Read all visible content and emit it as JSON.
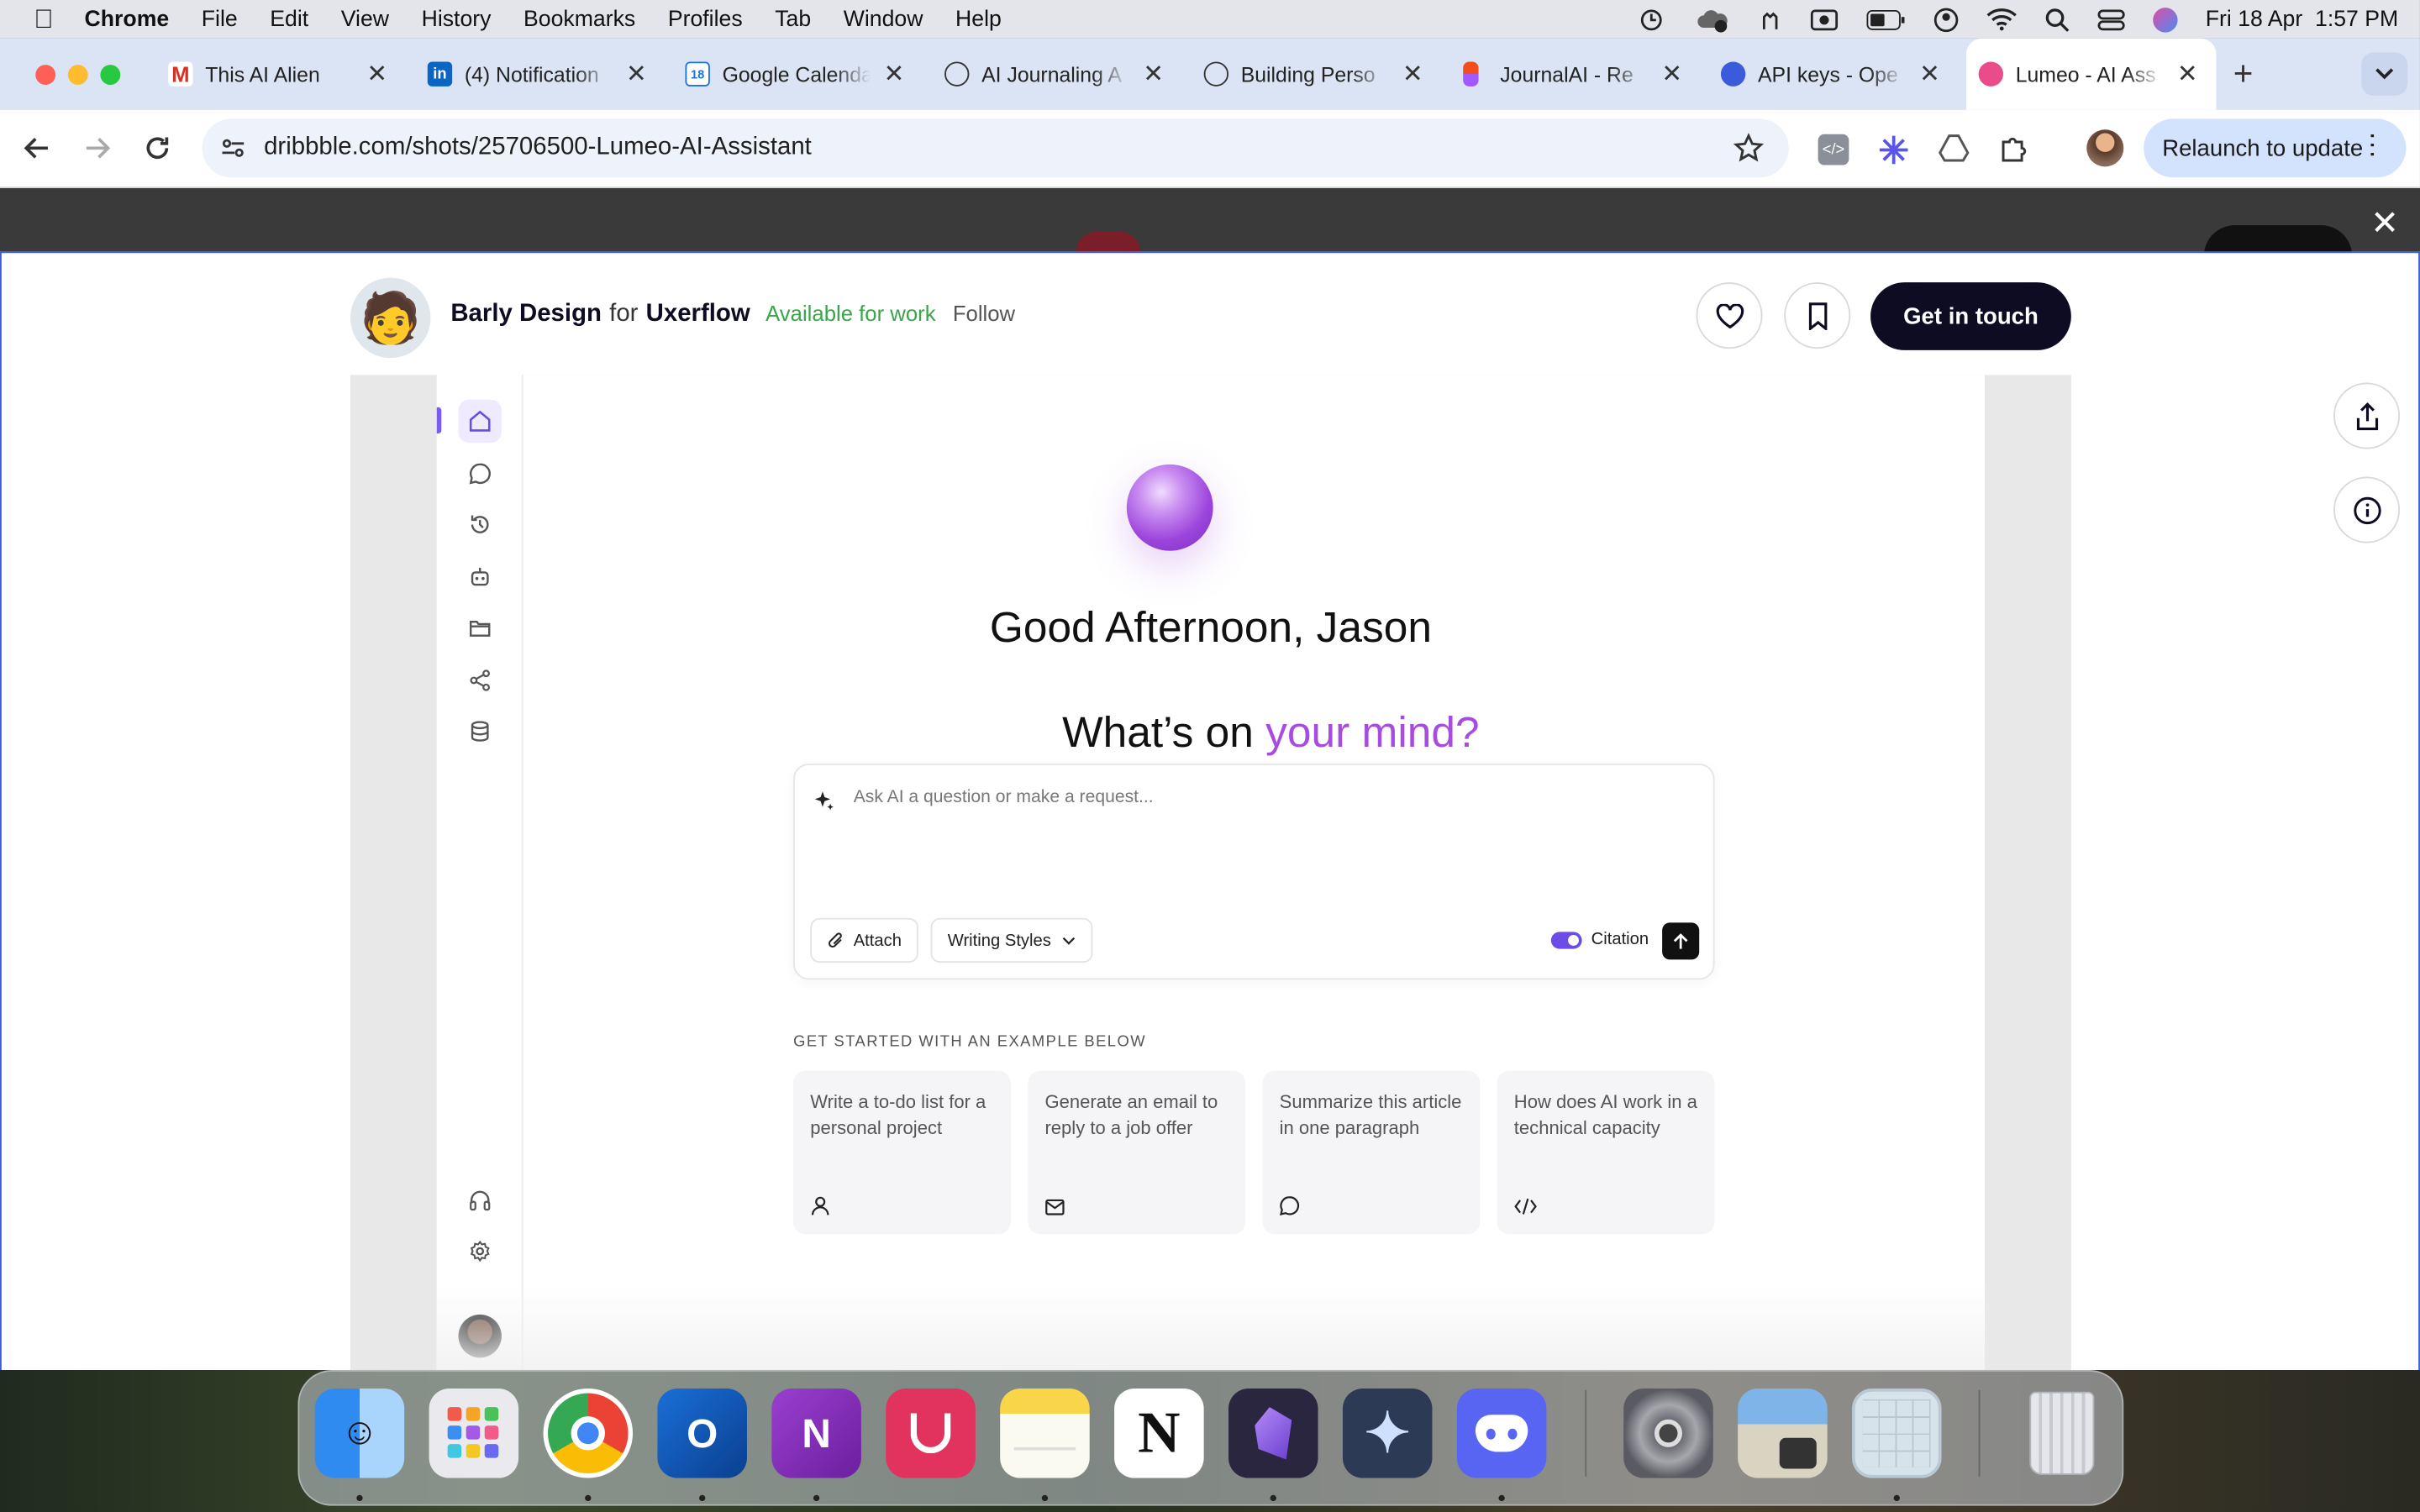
{
  "menubar": {
    "app_name": "Chrome",
    "items": [
      "File",
      "Edit",
      "View",
      "History",
      "Bookmarks",
      "Profiles",
      "Tab",
      "Window",
      "Help"
    ],
    "datetime": "Fri 18 Apr  1:57 PM"
  },
  "tabs": [
    {
      "title": "This AI Alien",
      "icon": "gmail-icon",
      "color": "#d93025"
    },
    {
      "title": "(4) Notification",
      "icon": "linkedin-icon",
      "color": "#0a66c2"
    },
    {
      "title": "Google Calenda",
      "icon": "calendar-icon",
      "color": "#1a73e8"
    },
    {
      "title": "AI Journaling A",
      "icon": "openai-icon",
      "color": "#333333"
    },
    {
      "title": "Building Perso",
      "icon": "openai-icon",
      "color": "#333333"
    },
    {
      "title": "JournalAI - Re",
      "icon": "figma-icon",
      "color": "#f24e1e"
    },
    {
      "title": "API keys - Ope",
      "icon": "openai-icon",
      "color": "#3b5bdb"
    },
    {
      "title": "Lumeo - AI Ass",
      "icon": "dribbble-icon",
      "color": "#ea4c89"
    }
  ],
  "address_bar": {
    "url": "dribbble.com/shots/25706500-Lumeo-AI-Assistant",
    "relaunch_label": "Relaunch to update"
  },
  "shot_header": {
    "designer": "Barly Design",
    "for_word": "for",
    "team": "Uxerflow",
    "availability": "Available for work",
    "follow_label": "Follow",
    "cta_label": "Get in touch",
    "availability_color": "#3aa54a"
  },
  "app": {
    "greeting": "Good Afternoon, Jason",
    "question_prefix": "What’s on ",
    "question_highlight": "your mind?",
    "highlight_color": "#a84ce0",
    "prompt_placeholder": "Ask AI a question or make a request...",
    "attach_label": "Attach",
    "writing_styles_label": "Writing Styles",
    "citation_label": "Citation",
    "citation_on": true,
    "examples_heading": "GET STARTED WITH AN EXAMPLE BELOW",
    "examples": [
      {
        "text": "Write a to-do list for a personal project",
        "icon": "user-icon"
      },
      {
        "text": "Generate an email to reply to a job offer",
        "icon": "mail-icon"
      },
      {
        "text": "Summarize this article in one paragraph",
        "icon": "chat-bubble-icon"
      },
      {
        "text": "How does AI work in a technical capacity",
        "icon": "code-icon"
      }
    ]
  },
  "dock_apps": [
    "Finder",
    "Launchpad",
    "Chrome",
    "Outlook",
    "OneNote",
    "Craft",
    "Notes",
    "Notion",
    "Obsidian",
    "Spark",
    "Discord",
    "System Settings",
    "Preview",
    "Screenshot",
    "Trash"
  ]
}
